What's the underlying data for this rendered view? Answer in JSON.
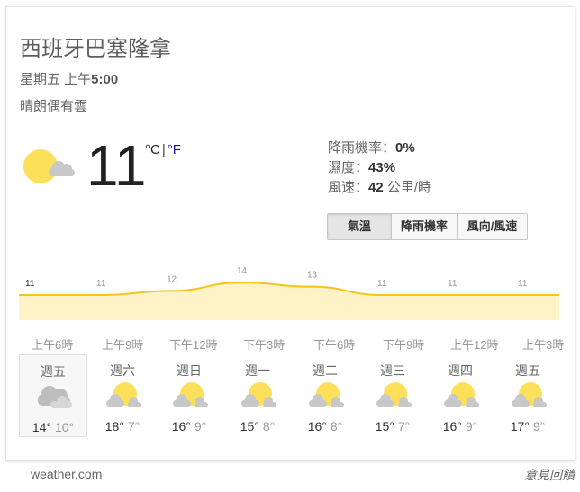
{
  "location": "西班牙巴塞隆拿",
  "day_label": "星期五 上午",
  "time": "5:00",
  "condition": "晴朗偶有雲",
  "current_icon": "partly-cloudy-icon",
  "temperature": "11",
  "unit_c": "°C",
  "unit_sep": "|",
  "unit_f": "°F",
  "stats": {
    "precip_label": "降雨機率：",
    "precip_value": "0%",
    "humidity_label": "濕度：",
    "humidity_value": "43%",
    "wind_label": "風速：",
    "wind_value": "42",
    "wind_unit": "公里/時"
  },
  "tabs": [
    {
      "label": "氣溫",
      "active": true
    },
    {
      "label": "降雨機率",
      "active": false
    },
    {
      "label": "風向/風速",
      "active": false
    }
  ],
  "chart_data": {
    "type": "area",
    "x": [
      "上午6時",
      "上午9時",
      "下午12時",
      "下午3時",
      "下午6時",
      "下午9時",
      "上午12時",
      "上午3時"
    ],
    "values": [
      11,
      11,
      12,
      14,
      13,
      11,
      11,
      11
    ],
    "labels": [
      "11",
      "11",
      "12",
      "14",
      "13",
      "11",
      "11",
      "11"
    ],
    "line_color": "#f5c518",
    "fill_color": "#fdf3c7"
  },
  "hours": [
    "上午6時",
    "上午9時",
    "下午12時",
    "下午3時",
    "下午6時",
    "下午9時",
    "上午12時",
    "上午3時"
  ],
  "days": [
    {
      "name": "週五",
      "icon": "cloudy-icon",
      "high": "14°",
      "low": "10°",
      "selected": true
    },
    {
      "name": "週六",
      "icon": "partly-cloudy-icon",
      "high": "18°",
      "low": "7°",
      "selected": false
    },
    {
      "name": "週日",
      "icon": "partly-cloudy-icon",
      "high": "16°",
      "low": "9°",
      "selected": false
    },
    {
      "name": "週一",
      "icon": "partly-cloudy-icon",
      "high": "15°",
      "low": "8°",
      "selected": false
    },
    {
      "name": "週二",
      "icon": "partly-cloudy-icon",
      "high": "16°",
      "low": "8°",
      "selected": false
    },
    {
      "name": "週三",
      "icon": "partly-cloudy-icon",
      "high": "15°",
      "low": "7°",
      "selected": false
    },
    {
      "name": "週四",
      "icon": "partly-cloudy-icon",
      "high": "16°",
      "low": "9°",
      "selected": false
    },
    {
      "name": "週五",
      "icon": "partly-cloudy-icon",
      "high": "17°",
      "low": "9°",
      "selected": false
    }
  ],
  "source": "weather.com",
  "feedback": "意見回饋"
}
